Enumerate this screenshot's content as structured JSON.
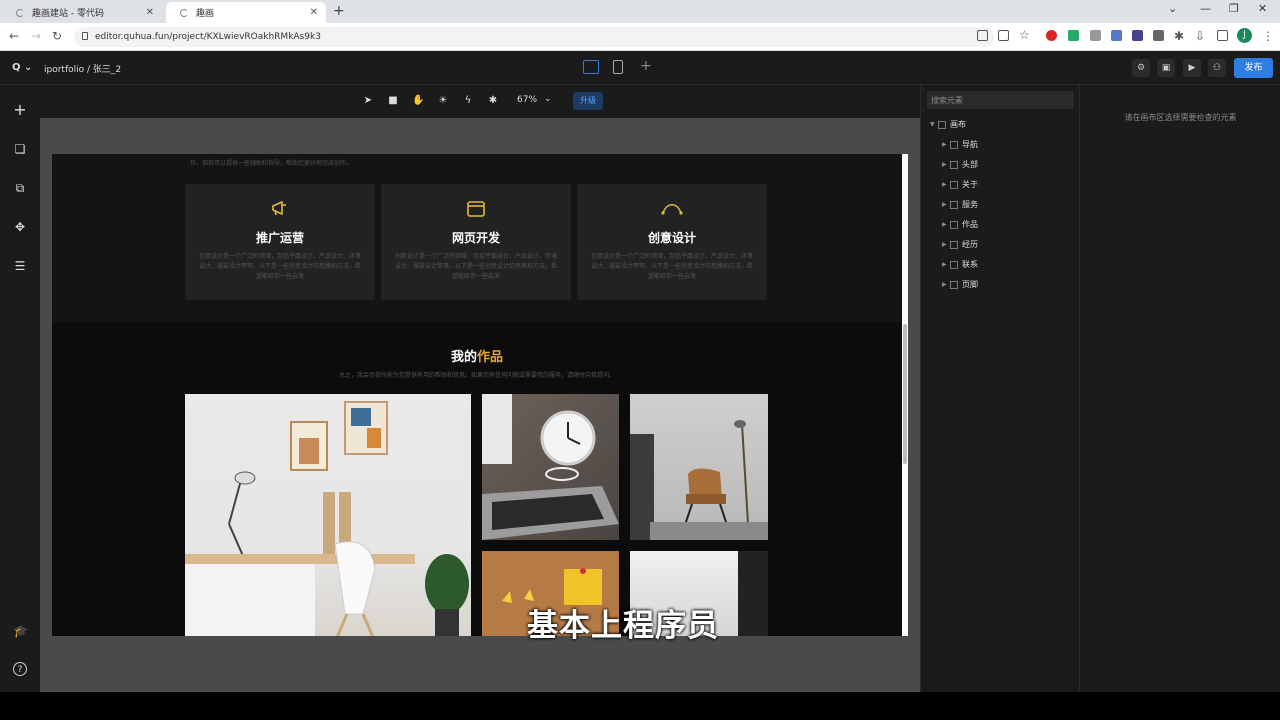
{
  "browser": {
    "tabs": [
      {
        "title": "趣画建站 - 零代码",
        "active": false
      },
      {
        "title": "趣画",
        "active": true
      }
    ],
    "url": "editor.quhua.fun/project/KXLwievROakhRMkAs9k3",
    "profile_initial": "J"
  },
  "app": {
    "logo": "Q",
    "breadcrumb": "iportfolio / 张三_2",
    "publish_label": "发布",
    "zoom": "67%",
    "upgrade_label": "升级"
  },
  "canvas": {
    "intro_text": "作。但我可以提供一些辅助和指导，帮助您更好地完成创作。",
    "services": [
      {
        "icon": "megaphone-icon",
        "title": "推广运营",
        "desc": "创意设计是一个广泛的领域，包括平面设计、产品设计、环境设计、服装设计等等。以下是一些创意设计的思路和方法，希望能给你一些启发"
      },
      {
        "icon": "browser-window-icon",
        "title": "网页开发",
        "desc": "创意设计是一个广泛的领域，包括平面设计、产品设计、环境设计、服装设计等等。以下是一些创意设计的思路和方法，希望能给你一些启发"
      },
      {
        "icon": "bezier-curve-icon",
        "title": "创意设计",
        "desc": "创意设计是一个广泛的领域，包括平面设计、产品设计、环境设计、服装设计等等。以下是一些创意设计的思路和方法，希望能给你一些启发"
      }
    ],
    "works_title_1": "我的",
    "works_title_2": "作品",
    "works_subtitle": "总之，我会尽我所能为您提供有用的帮助和信息。如果您有任何问题或需要我的服务，请随时向我提问。"
  },
  "layers": {
    "search_placeholder": "搜索元素",
    "root": "画布",
    "items": [
      "导航",
      "头部",
      "关于",
      "服务",
      "作品",
      "经历",
      "联系",
      "页脚"
    ]
  },
  "inspector": {
    "hint": "请在画布区选择需要检查的元素"
  },
  "video_subtitle": "基本上程序员",
  "colors": {
    "accent": "#e8a33a",
    "brand": "#2f7de1",
    "icon_gold": "#e2b93b"
  }
}
